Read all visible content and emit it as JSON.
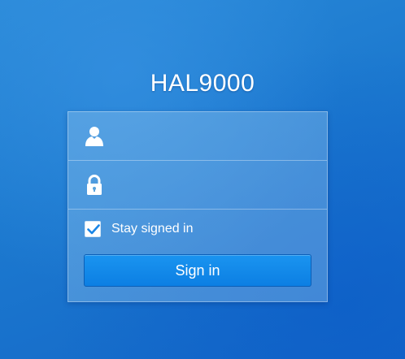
{
  "hostname": "HAL9000",
  "login": {
    "username": {
      "value": "",
      "placeholder": "",
      "icon": "user-icon"
    },
    "password": {
      "value": "",
      "placeholder": "",
      "icon": "lock-icon"
    },
    "stay_signed_in": {
      "label": "Stay signed in",
      "checked": true,
      "icon": "checkmark-icon"
    },
    "sign_in_label": "Sign in"
  },
  "colors": {
    "background": "#1c79cf",
    "button": "#0c7fe3",
    "checkmark": "#1a86e6",
    "text": "#ffffff"
  }
}
